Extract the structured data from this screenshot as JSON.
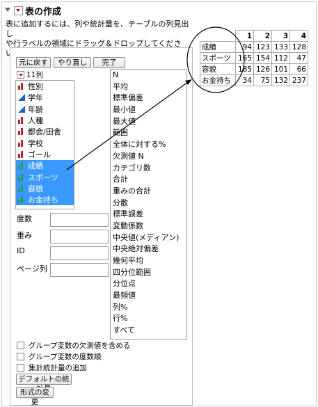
{
  "title": "表の作成",
  "instructions": [
    "表に追加するには、列や統計量を、テーブルの列見出し",
    "や行ラベルの領域にドラッグ＆ドロップしてください。"
  ],
  "buttons": {
    "undo": "元に戻す",
    "redo": "やり直し",
    "done": "完了",
    "default_stats": "デフォルトの統計量",
    "change_format": "形式の変更"
  },
  "column_count": "11列",
  "columns": [
    {
      "label": "性別",
      "icon": "nominal-icon"
    },
    {
      "label": "学年",
      "icon": "continuous-icon"
    },
    {
      "label": "年齢",
      "icon": "continuous-icon"
    },
    {
      "label": "人種",
      "icon": "nominal-icon"
    },
    {
      "label": "都会/田舎",
      "icon": "nominal-icon"
    },
    {
      "label": "学校",
      "icon": "nominal-icon"
    },
    {
      "label": "ゴール",
      "icon": "nominal-icon"
    },
    {
      "label": "成績",
      "icon": "ordinal-icon"
    },
    {
      "label": "スポーツ",
      "icon": "ordinal-icon"
    },
    {
      "label": "容貌",
      "icon": "ordinal-icon"
    },
    {
      "label": "お金持ち",
      "icon": "ordinal-icon"
    }
  ],
  "statistics": [
    "N",
    "平均",
    "標準偏差",
    "最小値",
    "最大値",
    "範囲",
    "全体に対する%",
    "欠測値 N",
    "カテゴリ数",
    "合計",
    "重みの合計",
    "分散",
    "標準誤差",
    "変動係数",
    "中央値(メディアン)",
    "中央絶対偏差",
    "幾何平均",
    "四分位範囲",
    "分位点",
    "最頻値",
    "列%",
    "行%",
    "すべて"
  ],
  "roles": [
    "度数",
    "重み",
    "ID",
    "ページ列"
  ],
  "checkboxes": [
    "グループ変数の欠測値を含める",
    "グループ変数の度数順",
    "集計統計量の追加"
  ],
  "preview": {
    "headers": [
      "1",
      "2",
      "3",
      "4"
    ],
    "rows": [
      {
        "label": "成績",
        "values": [
          "94",
          "123",
          "133",
          "128"
        ]
      },
      {
        "label": "スポーツ",
        "values": [
          "165",
          "154",
          "112",
          "47"
        ]
      },
      {
        "label": "容貌",
        "values": [
          "185",
          "126",
          "101",
          "66"
        ]
      },
      {
        "label": "お金持ち",
        "values": [
          "34",
          "75",
          "132",
          "237"
        ]
      }
    ]
  },
  "colors": {
    "selection": "#3a99ff",
    "nominal": "#b8262b",
    "ordinal": "#2e9a44",
    "continuous": "#1f5fbf",
    "menu_arrow": "#d0021b"
  }
}
